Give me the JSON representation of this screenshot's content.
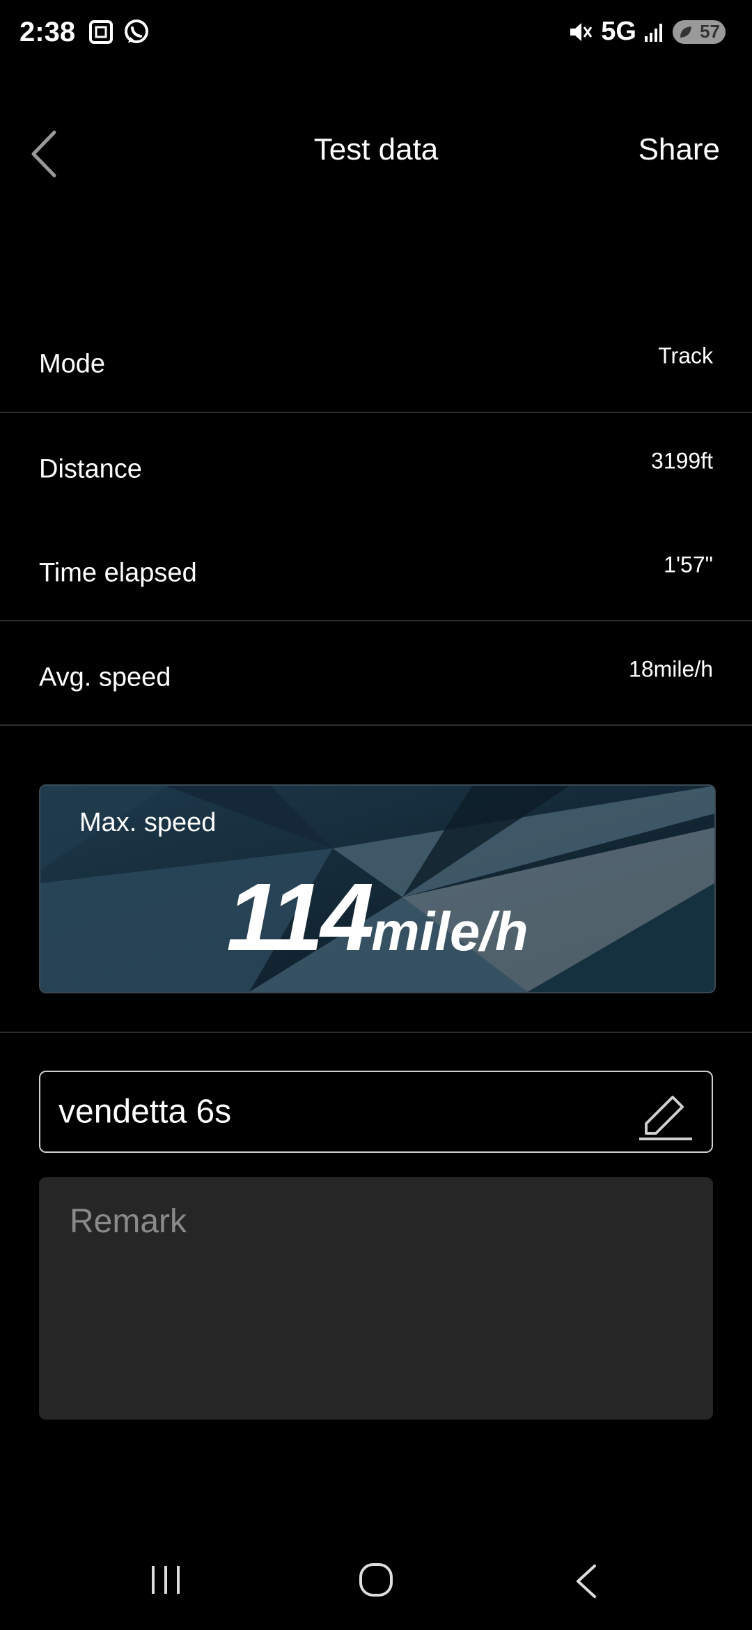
{
  "status_bar": {
    "time": "2:38",
    "network": "5G",
    "battery": "57",
    "icons": [
      "screenshot-icon",
      "whatsapp-icon",
      "mute-icon",
      "signal-icon",
      "battery-icon"
    ]
  },
  "header": {
    "title": "Test data",
    "share_label": "Share",
    "back_icon": "chevron-left-icon"
  },
  "rows": [
    {
      "label": "Mode",
      "value": "Track"
    },
    {
      "label": "Distance",
      "value": "3199ft"
    },
    {
      "label": "Time elapsed",
      "value": "1'57\""
    },
    {
      "label": "Avg. speed",
      "value": "18mile/h"
    }
  ],
  "max_speed": {
    "label": "Max. speed",
    "value": "114",
    "unit": "mile/h"
  },
  "name_field": {
    "value": "vendetta 6s",
    "icon": "edit-pencil-icon"
  },
  "remark": {
    "placeholder": "Remark"
  },
  "nav_bar": {
    "icons": [
      "recents-icon",
      "home-icon",
      "back-icon"
    ]
  },
  "colors": {
    "background": "#000000",
    "text": "#ffffff",
    "divider": "#2e2e2e",
    "remark_bg": "#262626",
    "card_bg": "#0f2230"
  }
}
